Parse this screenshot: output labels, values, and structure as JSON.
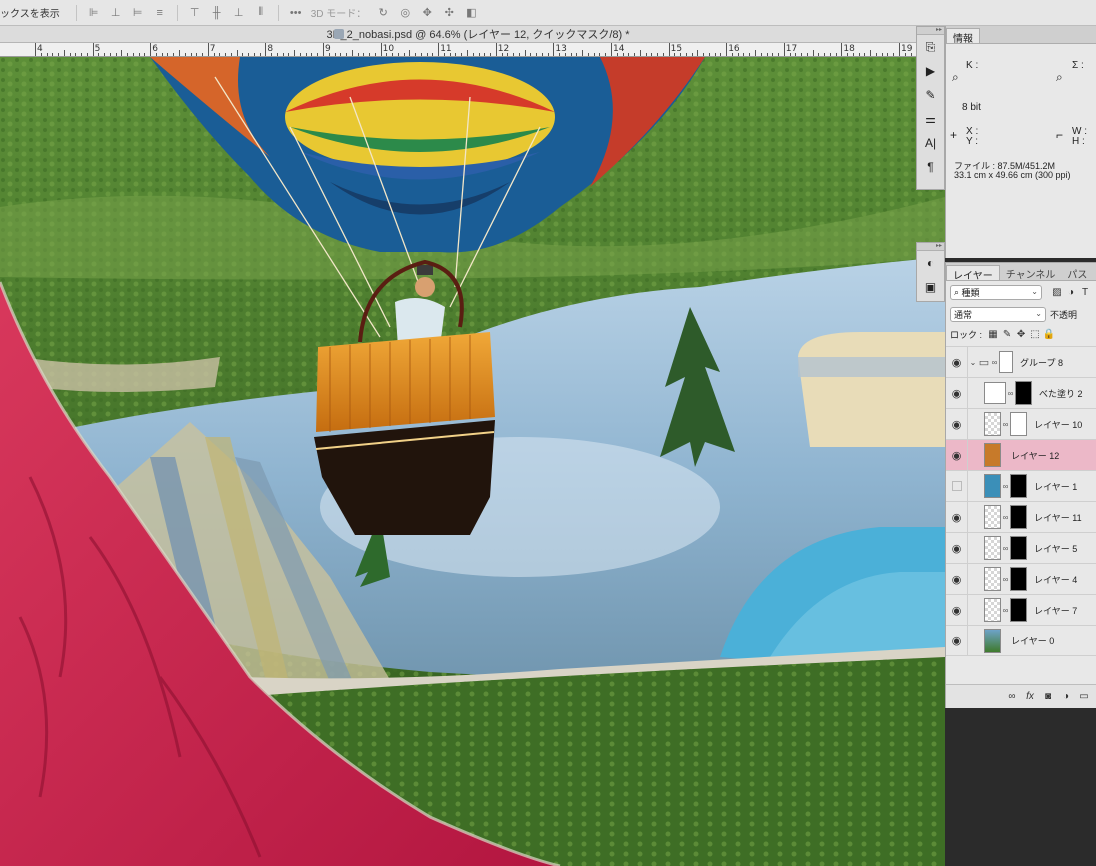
{
  "options_bar": {
    "transform_label": "ックスを表示",
    "mode_3d_label": "3D モード："
  },
  "document": {
    "tab_title": "3D_2_nobasi.psd @ 64.6% (レイヤー 12, クイックマスク/8) *"
  },
  "ruler": {
    "numbers": [
      "4",
      "5",
      "6",
      "7",
      "8",
      "9",
      "10",
      "11",
      "12",
      "13",
      "14",
      "15",
      "16",
      "17",
      "18",
      "19"
    ]
  },
  "info_panel": {
    "tab": "情報",
    "k_label": "K :",
    "sigma_label": "Σ :",
    "bit_depth": "8 bit",
    "x_label": "X :",
    "y_label": "Y :",
    "w_label": "W :",
    "h_label": "H :",
    "file_size": "ファイル : 87.5M/451.2M",
    "doc_size": "33.1 cm x 49.66 cm (300 ppi)"
  },
  "layers_panel": {
    "tabs": [
      "レイヤー",
      "チャンネル",
      "パス"
    ],
    "filter_value": "種類",
    "blend_mode": "通常",
    "opacity_label": "不透明",
    "lock_label": "ロック :",
    "layers": [
      {
        "name": "グループ 8",
        "visible": true,
        "type": "group"
      },
      {
        "name": "べた塗り 2",
        "visible": true,
        "type": "fill"
      },
      {
        "name": "レイヤー 10",
        "visible": true,
        "type": "masked"
      },
      {
        "name": "レイヤー 12",
        "visible": true,
        "type": "selected"
      },
      {
        "name": "レイヤー 1",
        "visible": false,
        "type": "masked"
      },
      {
        "name": "レイヤー 11",
        "visible": true,
        "type": "masked"
      },
      {
        "name": "レイヤー 5",
        "visible": true,
        "type": "masked"
      },
      {
        "name": "レイヤー 4",
        "visible": true,
        "type": "masked"
      },
      {
        "name": "レイヤー 7",
        "visible": true,
        "type": "masked"
      },
      {
        "name": "レイヤー 0",
        "visible": true,
        "type": "image"
      }
    ]
  },
  "colors": {
    "quick_mask": "#c8204a",
    "selected_layer": "#ecb8c8",
    "panel_bg": "#e8e8e8"
  }
}
